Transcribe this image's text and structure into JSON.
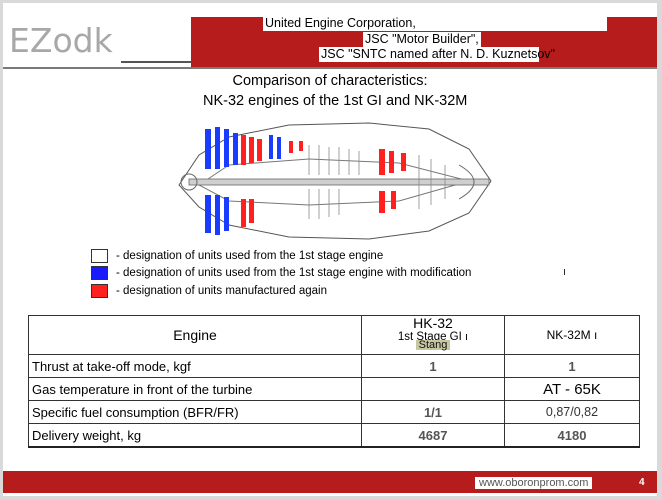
{
  "header": {
    "logo": "EZodk",
    "corp_line1": "United Engine Corporation,",
    "corp_line2": "JSC \"Motor Builder\",",
    "corp_line3": "JSC \"SNTC named after N. D. Kuznetsov\""
  },
  "title": {
    "line1": "Comparison of characteristics:",
    "line2": "NK-32 engines of the 1st GI and NK-32M"
  },
  "legend": {
    "items": [
      {
        "label": "- designation of units used from the 1st stage engine",
        "color": "#ffffff"
      },
      {
        "label": "- designation of units used from the 1st stage engine with modification",
        "color": "#1a1aff"
      },
      {
        "label": "- designation of units manufactured again",
        "color": "#ff2020"
      }
    ],
    "tick": "ı"
  },
  "table": {
    "header": {
      "engine": "Engine",
      "col1_main": "HK-32",
      "col1_sub": "1st Stage GI",
      "col1_tag": "Stang",
      "col1_mark": "ı",
      "col2": "NK-32M",
      "col2_mark": "ı"
    },
    "rows": [
      {
        "label": "Thrust at take-off mode, kgf",
        "v1": "1",
        "v2": "1"
      },
      {
        "label": "Gas temperature in front of the turbine",
        "v1": "",
        "v2": "AT - 65K"
      },
      {
        "label": "Specific fuel consumption (BFR/FR)",
        "v1": "1/1",
        "v2": "0,87/0,82"
      },
      {
        "label": "Delivery weight, kg",
        "v1": "4687",
        "v2": "4180"
      }
    ]
  },
  "footer": {
    "url": "www.oboronprom.com",
    "page": "4",
    "accent": "#b71c1c"
  }
}
